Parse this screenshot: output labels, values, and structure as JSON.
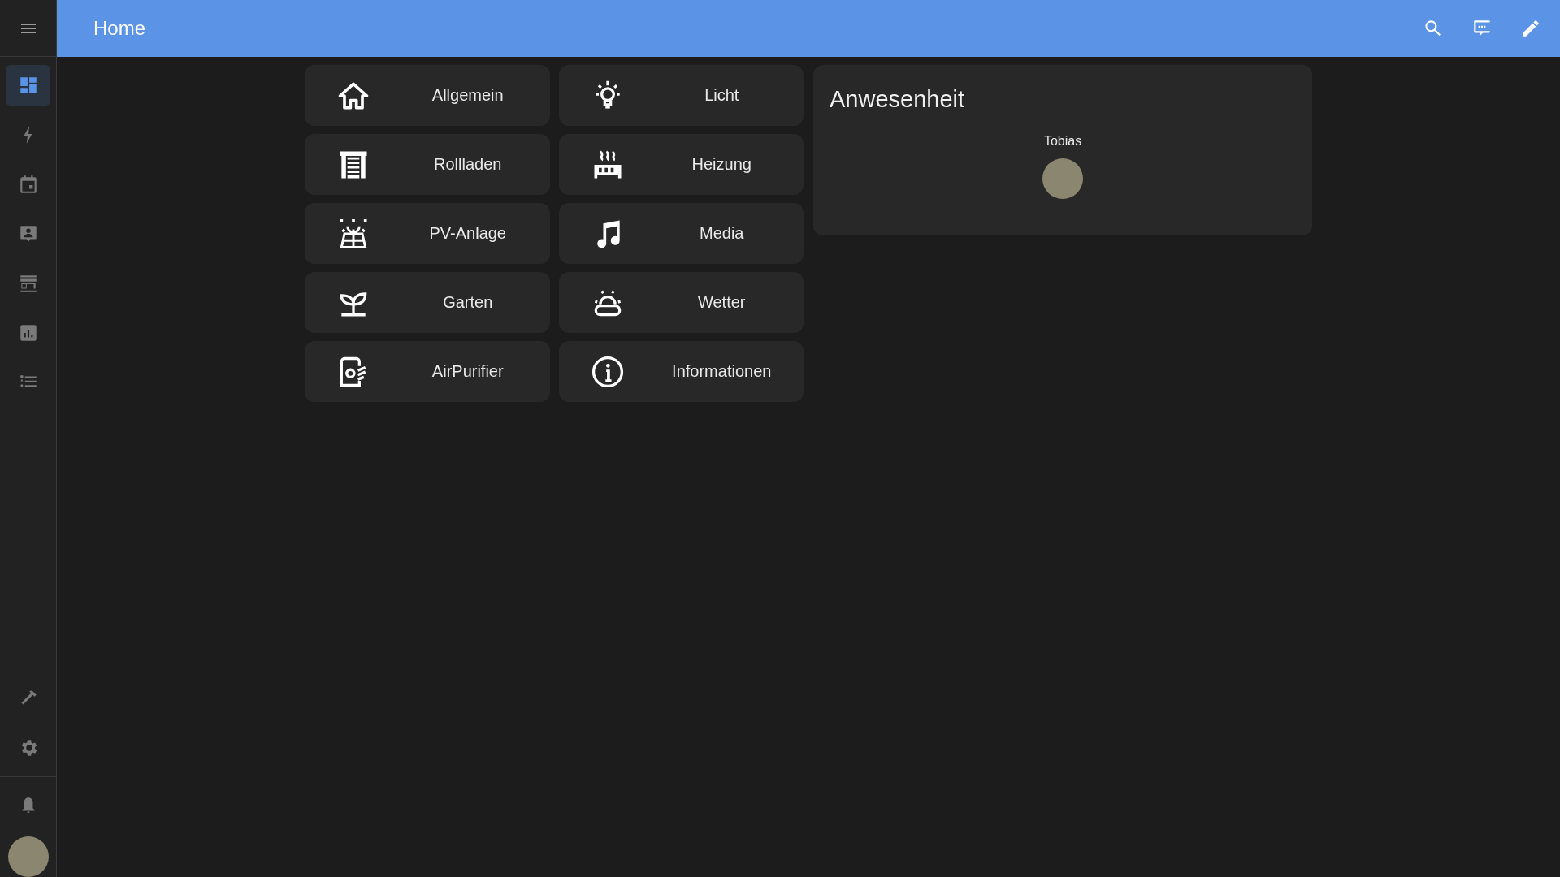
{
  "header": {
    "title": "Home"
  },
  "sidebar": {
    "items": [
      {
        "kind": "dashboard",
        "selected": true
      },
      {
        "kind": "energy",
        "selected": false
      },
      {
        "kind": "calendar",
        "selected": false
      },
      {
        "kind": "person",
        "selected": false
      },
      {
        "kind": "store",
        "selected": false
      },
      {
        "kind": "history",
        "selected": false
      },
      {
        "kind": "logbook",
        "selected": false
      }
    ],
    "bottom_items": [
      {
        "kind": "tools",
        "selected": false
      },
      {
        "kind": "settings",
        "selected": false
      }
    ]
  },
  "tiles": [
    {
      "label": "Allgemein",
      "kind": "home"
    },
    {
      "label": "Licht",
      "kind": "bulb"
    },
    {
      "label": "Rollladen",
      "kind": "shutter"
    },
    {
      "label": "Heizung",
      "kind": "radiator"
    },
    {
      "label": "PV-Anlage",
      "kind": "solar"
    },
    {
      "label": "Media",
      "kind": "music"
    },
    {
      "label": "Garten",
      "kind": "sprout"
    },
    {
      "label": "Wetter",
      "kind": "weather"
    },
    {
      "label": "AirPurifier",
      "kind": "purifier"
    },
    {
      "label": "Informationen",
      "kind": "info"
    }
  ],
  "presence": {
    "title": "Anwesenheit",
    "people": [
      {
        "name": "Tobias"
      }
    ]
  }
}
